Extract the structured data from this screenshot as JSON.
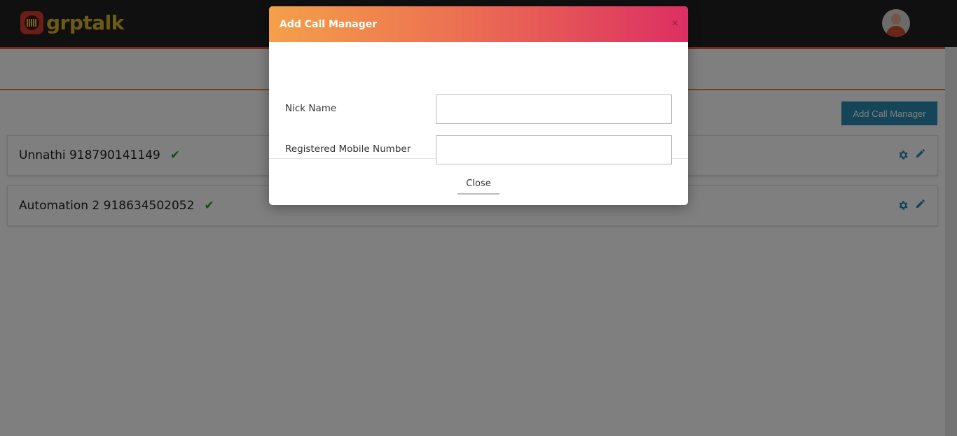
{
  "app": {
    "brand": "grptalk"
  },
  "toolbar": {
    "add_button_label": "Add Call Manager"
  },
  "managers": [
    {
      "name": "Unnathi 918790141149",
      "verified": true
    },
    {
      "name": "Automation 2 918634502052",
      "verified": true
    }
  ],
  "modal": {
    "title": "Add Call Manager",
    "close_x": "×",
    "fields": [
      {
        "label": "Nick Name",
        "value": "",
        "placeholder": ""
      },
      {
        "label": "Registered Mobile Number",
        "value": "",
        "placeholder": ""
      }
    ],
    "close_label": "Close"
  },
  "icons": {
    "check": "✔",
    "gear": "gear-icon",
    "pencil": "pencil-icon"
  },
  "colors": {
    "topbar": "#202020",
    "accent_orange": "#e9832e",
    "button_blue": "#2a8ab3",
    "icon_blue": "#2a8ab3",
    "check_green": "#2a9a2a",
    "modal_gradient_start": "#f4a04a",
    "modal_gradient_end": "#dc2f63"
  }
}
